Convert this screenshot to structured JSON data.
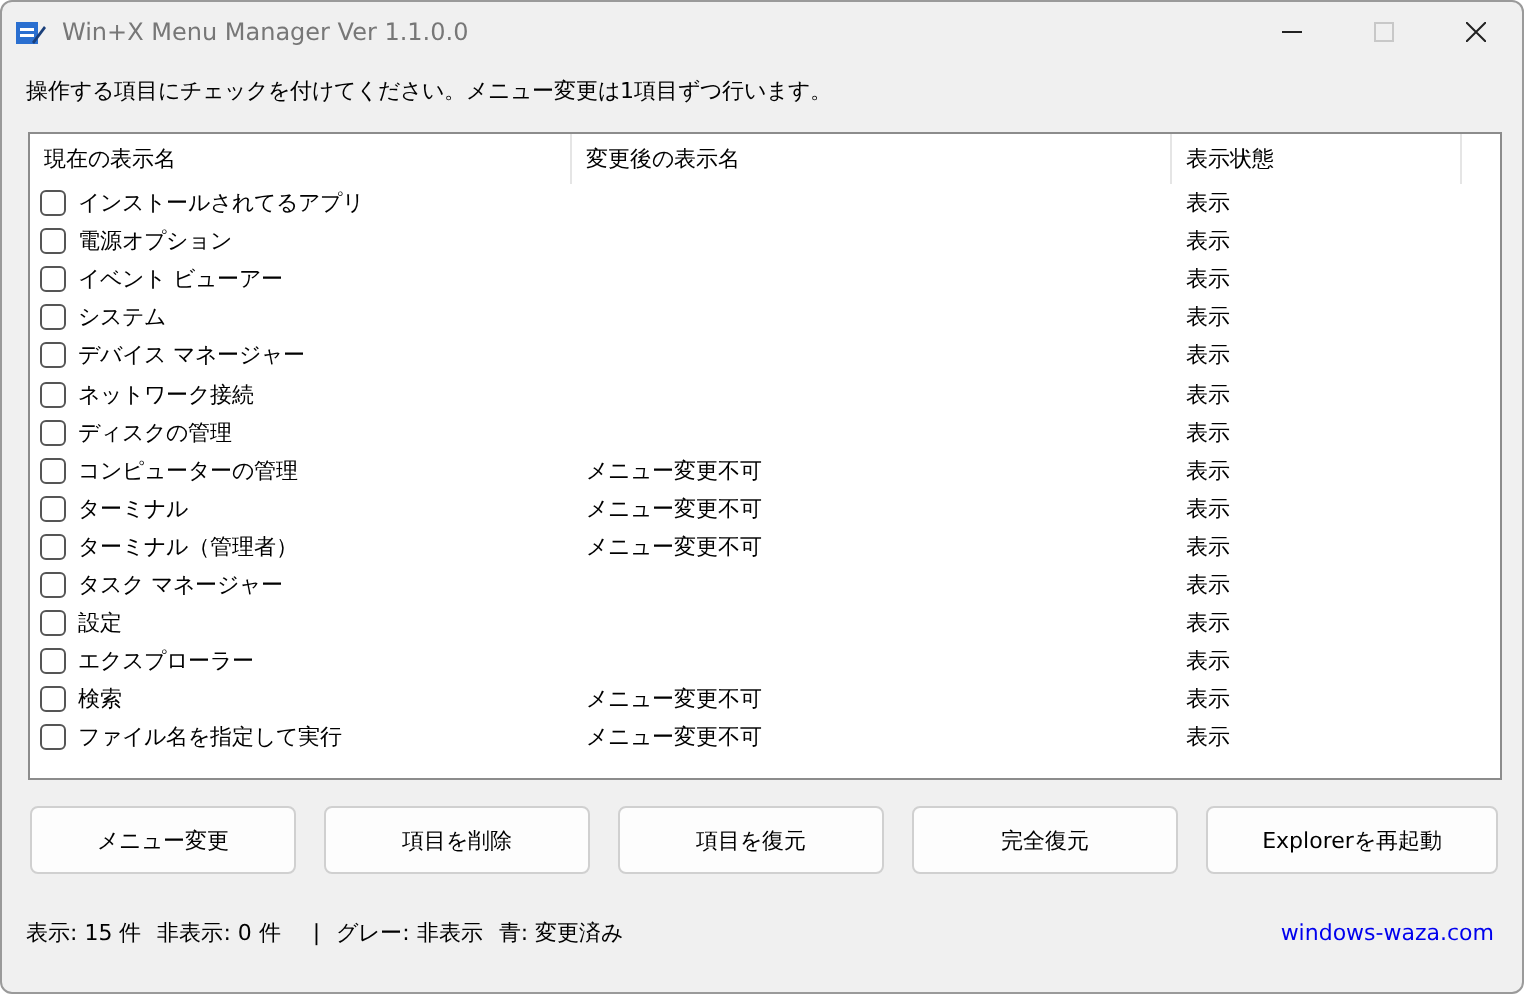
{
  "window": {
    "title": "Win+X Menu Manager Ver 1.1.0.0",
    "maximize_disabled": true
  },
  "instruction": "操作する項目にチェックを付けてください。メニュー変更は1項目ずつ行います。",
  "table": {
    "columns": [
      "現在の表示名",
      "変更後の表示名",
      "表示状態"
    ],
    "rows": [
      {
        "checked": false,
        "name": "インストールされてるアプリ",
        "status": "表示"
      },
      {
        "checked": false,
        "name": "電源オプション",
        "status": "表示"
      },
      {
        "checked": false,
        "name": "イベント ビューアー",
        "status": "表示"
      },
      {
        "checked": false,
        "name": "システム",
        "status": "表示"
      },
      {
        "checked": false,
        "name": "デバイス マネージャー",
        "status": "表示"
      },
      {
        "checked": false,
        "name": "ネットワーク接続",
        "status": "表示"
      },
      {
        "checked": false,
        "name": "ディスクの管理",
        "status": "表示"
      },
      {
        "checked": false,
        "name": "コンピューターの管理",
        "new_name": "メニュー変更不可",
        "status": "表示"
      },
      {
        "checked": false,
        "name": "ターミナル",
        "new_name": "メニュー変更不可",
        "status": "表示"
      },
      {
        "checked": false,
        "name": "ターミナル（管理者）",
        "new_name": "メニュー変更不可",
        "status": "表示"
      },
      {
        "checked": false,
        "name": "タスク マネージャー",
        "status": "表示"
      },
      {
        "checked": false,
        "name": "設定",
        "status": "表示"
      },
      {
        "checked": false,
        "name": "エクスプローラー",
        "status": "表示"
      },
      {
        "checked": false,
        "name": "検索",
        "new_name": "メニュー変更不可",
        "status": "表示"
      },
      {
        "checked": false,
        "name": "ファイル名を指定して実行",
        "new_name": "メニュー変更不可",
        "status": "表示"
      }
    ]
  },
  "buttons": [
    "メニュー変更",
    "項目を削除",
    "項目を復元",
    "完全復元",
    "Explorerを再起動"
  ],
  "status_bar": {
    "items": [
      "表示: 15 件",
      "非表示: 0 件",
      "|",
      "グレー: 非表示",
      "青: 変更済み"
    ],
    "link": "windows-waza.com"
  }
}
